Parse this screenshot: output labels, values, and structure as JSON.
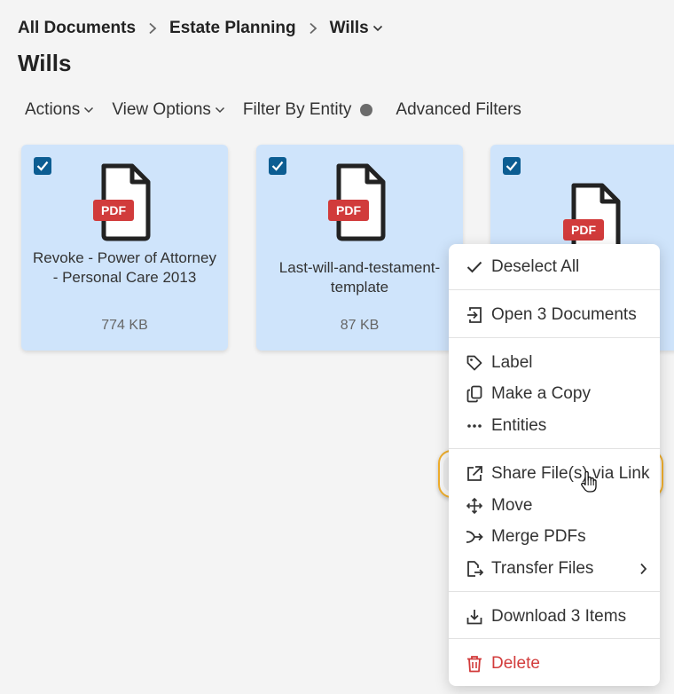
{
  "breadcrumb": {
    "items": [
      "All Documents",
      "Estate Planning"
    ],
    "current": "Wills"
  },
  "page_title": "Wills",
  "toolbar": {
    "actions": "Actions",
    "view_options": "View Options",
    "filter_by_entity": "Filter By Entity",
    "advanced_filters": "Advanced Filters"
  },
  "files": [
    {
      "name": "Revoke - Power of Attorney - Personal Care 2013",
      "size": "774 KB",
      "type": "PDF",
      "selected": true
    },
    {
      "name": "Last-will-and-testament-template",
      "size": "87 KB",
      "type": "PDF",
      "selected": true
    },
    {
      "name": "",
      "size": "",
      "type": "PDF",
      "selected": true
    }
  ],
  "context_menu": {
    "deselect_all": "Deselect All",
    "open_documents": "Open 3 Documents",
    "label": "Label",
    "make_a_copy": "Make a Copy",
    "entities": "Entities",
    "share_via_link": "Share File(s) via Link",
    "move": "Move",
    "merge_pdfs": "Merge PDFs",
    "transfer_files": "Transfer Files",
    "download_items": "Download 3 Items",
    "delete": "Delete"
  },
  "colors": {
    "card_bg": "#cfe4fb",
    "checkbox": "#0c5d92",
    "pdf_badge": "#d13b3b",
    "highlight": "#efae2c",
    "delete": "#d23b3b"
  },
  "icons": [
    "chevron-right-icon",
    "chevron-down-icon",
    "checkbox-checked-icon",
    "pdf-file-icon",
    "check-icon",
    "open-document-icon",
    "tag-icon",
    "copy-icon",
    "more-horizontal-icon",
    "external-link-icon",
    "move-icon",
    "merge-icon",
    "transfer-icon",
    "download-icon",
    "trash-icon",
    "hand-cursor-icon"
  ]
}
